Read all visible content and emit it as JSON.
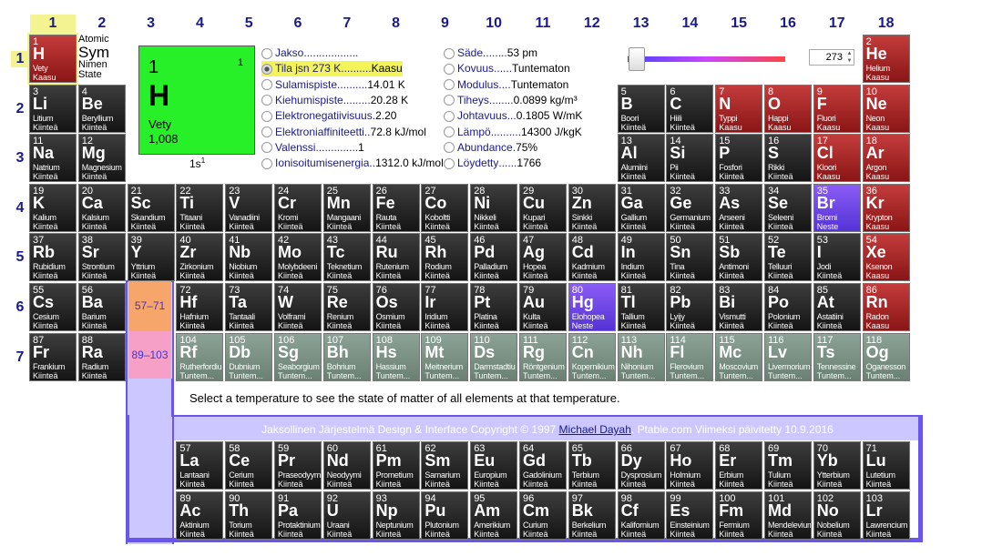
{
  "groups": [
    "1",
    "2",
    "3",
    "4",
    "5",
    "6",
    "7",
    "8",
    "9",
    "10",
    "11",
    "12",
    "13",
    "14",
    "15",
    "16",
    "17",
    "18"
  ],
  "periods": [
    "1",
    "2",
    "3",
    "4",
    "5",
    "6",
    "7"
  ],
  "legend": {
    "n": "Atomic",
    "s": "Sym",
    "nm": "Nimen",
    "st": "State"
  },
  "selected": {
    "n": "1",
    "s": "H",
    "nm": "Vety",
    "w": "1,008",
    "k": "1",
    "ec": "1s",
    "ec_sup": "1"
  },
  "props_left": [
    {
      "label": "Jakso",
      "dots": "..................",
      "value": "",
      "on": false
    },
    {
      "label": "Tila jsn 273 K",
      "dots": "..........",
      "value": "Kaasu",
      "on": true
    },
    {
      "label": "Sulamispiste",
      "dots": "..........",
      "value": "14.01 K",
      "on": false
    },
    {
      "label": "Kiehumispiste",
      "dots": ".........",
      "value": "20.28 K",
      "on": false
    },
    {
      "label": "Elektronegatiivisuus",
      "dots": ".",
      "value": "2.20",
      "on": false
    },
    {
      "label": "Elektroniaffiniteetti",
      "dots": "..",
      "value": "72.8 kJ/mol",
      "on": false
    },
    {
      "label": "Valenssi",
      "dots": "..............",
      "value": "1",
      "on": false
    },
    {
      "label": "Ionisoitumisenergia",
      "dots": "..",
      "value": "1312.0 kJ/mol",
      "on": false
    }
  ],
  "props_right": [
    {
      "label": "Säde",
      "dots": "........",
      "value": "53 pm",
      "on": false
    },
    {
      "label": "Kovuus",
      "dots": "......",
      "value": "Tuntematon",
      "on": false
    },
    {
      "label": "Modulus",
      "dots": "....",
      "value": "Tuntematon",
      "on": false
    },
    {
      "label": "Tiheys",
      "dots": "........",
      "value": "0.0899 kg/m³",
      "on": false
    },
    {
      "label": "Johtavuus",
      "dots": "...",
      "value": "0.1805 W/mK",
      "on": false
    },
    {
      "label": "Lämpö",
      "dots": "..........",
      "value": "14300 J/kgK",
      "on": false
    },
    {
      "label": "Abundance",
      "dots": ".",
      "value": "75%",
      "on": false
    },
    {
      "label": "Löydetty",
      "dots": "......",
      "value": "1766",
      "on": false
    }
  ],
  "temperature": "273",
  "lanthanide_range": "57–71",
  "actinide_range": "89–103",
  "hint": "Select a temperature to see the state of matter of all elements at that temperature.",
  "copyright_pre": "Jaksollinen Järjestelmä Design & Interface Copyright © 1997 ",
  "copyright_link": "Michael Dayah",
  "copyright_post": ". Ptable.com Viimeksi päivitetty 10.9.2016",
  "elements": [
    [
      "1",
      "H",
      "Vety",
      "Kaasu",
      1,
      1,
      "gas"
    ],
    [
      "2",
      "He",
      "Helium",
      "Kaasu",
      18,
      1,
      "gas"
    ],
    [
      "3",
      "Li",
      "Litium",
      "Kiinteä",
      1,
      2,
      "s"
    ],
    [
      "4",
      "Be",
      "Beryllium",
      "Kiinteä",
      2,
      2,
      "s"
    ],
    [
      "5",
      "B",
      "Boori",
      "Kiinteä",
      13,
      2,
      "s"
    ],
    [
      "6",
      "C",
      "Hiili",
      "Kiinteä",
      14,
      2,
      "s"
    ],
    [
      "7",
      "N",
      "Typpi",
      "Kaasu",
      15,
      2,
      "gas"
    ],
    [
      "8",
      "O",
      "Happi",
      "Kaasu",
      16,
      2,
      "gas"
    ],
    [
      "9",
      "F",
      "Fluori",
      "Kaasu",
      17,
      2,
      "gas"
    ],
    [
      "10",
      "Ne",
      "Neon",
      "Kaasu",
      18,
      2,
      "gas"
    ],
    [
      "11",
      "Na",
      "Natrium",
      "Kiinteä",
      1,
      3,
      "s"
    ],
    [
      "12",
      "Mg",
      "Magnesium",
      "Kiinteä",
      2,
      3,
      "s"
    ],
    [
      "13",
      "Al",
      "Alumiini",
      "Kiinteä",
      13,
      3,
      "s"
    ],
    [
      "14",
      "Si",
      "Pii",
      "Kiinteä",
      14,
      3,
      "s"
    ],
    [
      "15",
      "P",
      "Fosfori",
      "Kiinteä",
      15,
      3,
      "s"
    ],
    [
      "16",
      "S",
      "Rikki",
      "Kiinteä",
      16,
      3,
      "s"
    ],
    [
      "17",
      "Cl",
      "Kloori",
      "Kaasu",
      17,
      3,
      "gas"
    ],
    [
      "18",
      "Ar",
      "Argon",
      "Kaasu",
      18,
      3,
      "gas"
    ],
    [
      "19",
      "K",
      "Kalium",
      "Kiinteä",
      1,
      4,
      "s"
    ],
    [
      "20",
      "Ca",
      "Kalsium",
      "Kiinteä",
      2,
      4,
      "s"
    ],
    [
      "21",
      "Sc",
      "Skandium",
      "Kiinteä",
      3,
      4,
      "s"
    ],
    [
      "22",
      "Ti",
      "Titaani",
      "Kiinteä",
      4,
      4,
      "s"
    ],
    [
      "23",
      "V",
      "Vanadiini",
      "Kiinteä",
      5,
      4,
      "s"
    ],
    [
      "24",
      "Cr",
      "Kromi",
      "Kiinteä",
      6,
      4,
      "s"
    ],
    [
      "25",
      "Mn",
      "Mangaani",
      "Kiinteä",
      7,
      4,
      "s"
    ],
    [
      "26",
      "Fe",
      "Rauta",
      "Kiinteä",
      8,
      4,
      "s"
    ],
    [
      "27",
      "Co",
      "Koboltti",
      "Kiinteä",
      9,
      4,
      "s"
    ],
    [
      "28",
      "Ni",
      "Nikkeli",
      "Kiinteä",
      10,
      4,
      "s"
    ],
    [
      "29",
      "Cu",
      "Kupari",
      "Kiinteä",
      11,
      4,
      "s"
    ],
    [
      "30",
      "Zn",
      "Sinkki",
      "Kiinteä",
      12,
      4,
      "s"
    ],
    [
      "31",
      "Ga",
      "Gallium",
      "Kiinteä",
      13,
      4,
      "s"
    ],
    [
      "32",
      "Ge",
      "Germanium",
      "Kiinteä",
      14,
      4,
      "s"
    ],
    [
      "33",
      "As",
      "Arseeni",
      "Kiinteä",
      15,
      4,
      "s"
    ],
    [
      "34",
      "Se",
      "Seleeni",
      "Kiinteä",
      16,
      4,
      "s"
    ],
    [
      "35",
      "Br",
      "Bromi",
      "Neste",
      17,
      4,
      "liq"
    ],
    [
      "36",
      "Kr",
      "Krypton",
      "Kaasu",
      18,
      4,
      "gas"
    ],
    [
      "37",
      "Rb",
      "Rubidium",
      "Kiinteä",
      1,
      5,
      "s"
    ],
    [
      "38",
      "Sr",
      "Strontium",
      "Kiinteä",
      2,
      5,
      "s"
    ],
    [
      "39",
      "Y",
      "Yttrium",
      "Kiinteä",
      3,
      5,
      "s"
    ],
    [
      "40",
      "Zr",
      "Zirkonium",
      "Kiinteä",
      4,
      5,
      "s"
    ],
    [
      "41",
      "Nb",
      "Niobium",
      "Kiinteä",
      5,
      5,
      "s"
    ],
    [
      "42",
      "Mo",
      "Molybdeeni",
      "Kiinteä",
      6,
      5,
      "s"
    ],
    [
      "43",
      "Tc",
      "Teknetium",
      "Kiinteä",
      7,
      5,
      "s"
    ],
    [
      "44",
      "Ru",
      "Rutenium",
      "Kiinteä",
      8,
      5,
      "s"
    ],
    [
      "45",
      "Rh",
      "Rodium",
      "Kiinteä",
      9,
      5,
      "s"
    ],
    [
      "46",
      "Pd",
      "Palladium",
      "Kiinteä",
      10,
      5,
      "s"
    ],
    [
      "47",
      "Ag",
      "Hopea",
      "Kiinteä",
      11,
      5,
      "s"
    ],
    [
      "48",
      "Cd",
      "Kadmium",
      "Kiinteä",
      12,
      5,
      "s"
    ],
    [
      "49",
      "In",
      "Indium",
      "Kiinteä",
      13,
      5,
      "s"
    ],
    [
      "50",
      "Sn",
      "Tina",
      "Kiinteä",
      14,
      5,
      "s"
    ],
    [
      "51",
      "Sb",
      "Antimoni",
      "Kiinteä",
      15,
      5,
      "s"
    ],
    [
      "52",
      "Te",
      "Telluuri",
      "Kiinteä",
      16,
      5,
      "s"
    ],
    [
      "53",
      "I",
      "Jodi",
      "Kiinteä",
      17,
      5,
      "s"
    ],
    [
      "54",
      "Xe",
      "Ksenon",
      "Kaasu",
      18,
      5,
      "gas"
    ],
    [
      "55",
      "Cs",
      "Cesium",
      "Kiinteä",
      1,
      6,
      "s"
    ],
    [
      "56",
      "Ba",
      "Barium",
      "Kiinteä",
      2,
      6,
      "s"
    ],
    [
      "72",
      "Hf",
      "Hafnium",
      "Kiinteä",
      4,
      6,
      "s"
    ],
    [
      "73",
      "Ta",
      "Tantaali",
      "Kiinteä",
      5,
      6,
      "s"
    ],
    [
      "74",
      "W",
      "Volframi",
      "Kiinteä",
      6,
      6,
      "s"
    ],
    [
      "75",
      "Re",
      "Renium",
      "Kiinteä",
      7,
      6,
      "s"
    ],
    [
      "76",
      "Os",
      "Osmium",
      "Kiinteä",
      8,
      6,
      "s"
    ],
    [
      "77",
      "Ir",
      "Iridium",
      "Kiinteä",
      9,
      6,
      "s"
    ],
    [
      "78",
      "Pt",
      "Platina",
      "Kiinteä",
      10,
      6,
      "s"
    ],
    [
      "79",
      "Au",
      "Kulta",
      "Kiinteä",
      11,
      6,
      "s"
    ],
    [
      "80",
      "Hg",
      "Elohopea",
      "Neste",
      12,
      6,
      "liq"
    ],
    [
      "81",
      "Tl",
      "Tallium",
      "Kiinteä",
      13,
      6,
      "s"
    ],
    [
      "82",
      "Pb",
      "Lyijy",
      "Kiinteä",
      14,
      6,
      "s"
    ],
    [
      "83",
      "Bi",
      "Vismutti",
      "Kiinteä",
      15,
      6,
      "s"
    ],
    [
      "84",
      "Po",
      "Polonium",
      "Kiinteä",
      16,
      6,
      "s"
    ],
    [
      "85",
      "At",
      "Astatiini",
      "Kiinteä",
      17,
      6,
      "s"
    ],
    [
      "86",
      "Rn",
      "Radon",
      "Kaasu",
      18,
      6,
      "gas"
    ],
    [
      "87",
      "Fr",
      "Frankium",
      "Kiinteä",
      1,
      7,
      "s"
    ],
    [
      "88",
      "Ra",
      "Radium",
      "Kiinteä",
      2,
      7,
      "s"
    ],
    [
      "104",
      "Rf",
      "Rutherfordiu",
      "Tuntem...",
      4,
      7,
      "unk"
    ],
    [
      "105",
      "Db",
      "Dubnium",
      "Tuntem...",
      5,
      7,
      "unk"
    ],
    [
      "106",
      "Sg",
      "Seaborgium",
      "Tuntem...",
      6,
      7,
      "unk"
    ],
    [
      "107",
      "Bh",
      "Bohrium",
      "Tuntem...",
      7,
      7,
      "unk"
    ],
    [
      "108",
      "Hs",
      "Hassium",
      "Tuntem...",
      8,
      7,
      "unk"
    ],
    [
      "109",
      "Mt",
      "Meitnerium",
      "Tuntem...",
      9,
      7,
      "unk"
    ],
    [
      "110",
      "Ds",
      "Darmstadtiu",
      "Tuntem...",
      10,
      7,
      "unk"
    ],
    [
      "111",
      "Rg",
      "Röntgenium",
      "Tuntem...",
      11,
      7,
      "unk"
    ],
    [
      "112",
      "Cn",
      "Kopernikium",
      "Tuntem...",
      12,
      7,
      "unk"
    ],
    [
      "113",
      "Nh",
      "Nihonium",
      "Tuntem...",
      13,
      7,
      "unk"
    ],
    [
      "114",
      "Fl",
      "Flerovium",
      "Tuntem...",
      14,
      7,
      "unk"
    ],
    [
      "115",
      "Mc",
      "Moscovium",
      "Tuntem...",
      15,
      7,
      "unk"
    ],
    [
      "116",
      "Lv",
      "Livermorium",
      "Tuntem...",
      16,
      7,
      "unk"
    ],
    [
      "117",
      "Ts",
      "Tennessine",
      "Tuntem...",
      17,
      7,
      "unk"
    ],
    [
      "118",
      "Og",
      "Oganesson",
      "Tuntem...",
      18,
      7,
      "unk"
    ],
    [
      "57",
      "La",
      "Lantaani",
      "Kiinteä",
      4,
      9,
      "s"
    ],
    [
      "58",
      "Ce",
      "Cerium",
      "Kiinteä",
      5,
      9,
      "s"
    ],
    [
      "59",
      "Pr",
      "Praseodyymi",
      "Kiinteä",
      6,
      9,
      "s"
    ],
    [
      "60",
      "Nd",
      "Neodyymi",
      "Kiinteä",
      7,
      9,
      "s"
    ],
    [
      "61",
      "Pm",
      "Prometium",
      "Kiinteä",
      8,
      9,
      "s"
    ],
    [
      "62",
      "Sm",
      "Samarium",
      "Kiinteä",
      9,
      9,
      "s"
    ],
    [
      "63",
      "Eu",
      "Europium",
      "Kiinteä",
      10,
      9,
      "s"
    ],
    [
      "64",
      "Gd",
      "Gadolinium",
      "Kiinteä",
      11,
      9,
      "s"
    ],
    [
      "65",
      "Tb",
      "Terbium",
      "Kiinteä",
      12,
      9,
      "s"
    ],
    [
      "66",
      "Dy",
      "Dysprosium",
      "Kiinteä",
      13,
      9,
      "s"
    ],
    [
      "67",
      "Ho",
      "Holmium",
      "Kiinteä",
      14,
      9,
      "s"
    ],
    [
      "68",
      "Er",
      "Erbium",
      "Kiinteä",
      15,
      9,
      "s"
    ],
    [
      "69",
      "Tm",
      "Tulium",
      "Kiinteä",
      16,
      9,
      "s"
    ],
    [
      "70",
      "Yb",
      "Ytterbium",
      "Kiinteä",
      17,
      9,
      "s"
    ],
    [
      "71",
      "Lu",
      "Lutetium",
      "Kiinteä",
      18,
      9,
      "s"
    ],
    [
      "89",
      "Ac",
      "Aktinium",
      "Kiinteä",
      4,
      10,
      "s"
    ],
    [
      "90",
      "Th",
      "Torium",
      "Kiinteä",
      5,
      10,
      "s"
    ],
    [
      "91",
      "Pa",
      "Protaktinium",
      "Kiinteä",
      6,
      10,
      "s"
    ],
    [
      "92",
      "U",
      "Uraani",
      "Kiinteä",
      7,
      10,
      "s"
    ],
    [
      "93",
      "Np",
      "Neptunium",
      "Kiinteä",
      8,
      10,
      "s"
    ],
    [
      "94",
      "Pu",
      "Plutonium",
      "Kiinteä",
      9,
      10,
      "s"
    ],
    [
      "95",
      "Am",
      "Amerikium",
      "Kiinteä",
      10,
      10,
      "s"
    ],
    [
      "96",
      "Cm",
      "Curium",
      "Kiinteä",
      11,
      10,
      "s"
    ],
    [
      "97",
      "Bk",
      "Berkelium",
      "Kiinteä",
      12,
      10,
      "s"
    ],
    [
      "98",
      "Cf",
      "Kalifornium",
      "Kiinteä",
      13,
      10,
      "s"
    ],
    [
      "99",
      "Es",
      "Einsteinium",
      "Kiinteä",
      14,
      10,
      "s"
    ],
    [
      "100",
      "Fm",
      "Fermium",
      "Kiinteä",
      15,
      10,
      "s"
    ],
    [
      "101",
      "Md",
      "Mendelevium",
      "Kiinteä",
      16,
      10,
      "s"
    ],
    [
      "102",
      "No",
      "Nobelium",
      "Kiinteä",
      17,
      10,
      "s"
    ],
    [
      "103",
      "Lr",
      "Lawrencium",
      "Kiinteä",
      18,
      10,
      "s"
    ]
  ]
}
